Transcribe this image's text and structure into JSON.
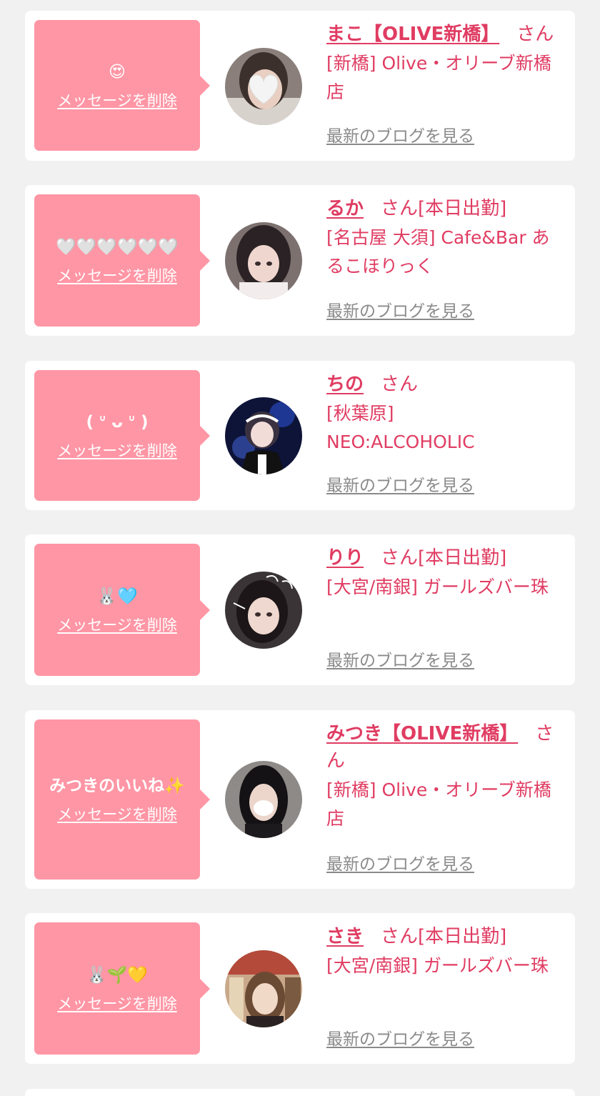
{
  "delete_label": "メッセージを削除",
  "blog_label": "最新のブログを見る",
  "colors": {
    "accent": "#e03c62",
    "bubble": "#ff96a5",
    "background": "#f1f1f1"
  },
  "cards": [
    {
      "message": "😍",
      "name": "まこ【OLIVE新橋】",
      "san": "さん",
      "status": "",
      "shop": "[新橋] Olive・オリーブ新橋店",
      "avatar": "heart-sticker-photo"
    },
    {
      "message": "🤍🤍🤍🤍🤍🤍",
      "name": "るか",
      "san": "さん",
      "status": "[本日出勤]",
      "shop": "[名古屋 大須] Cafe&Bar あるこほりっく",
      "avatar": "girl-photo"
    },
    {
      "message": "(  ᐡ ᴗ ᐡ )",
      "name": "ちの",
      "san": "さん",
      "status": "",
      "shop": "[秋葉原] NEO:ALCOHOLIC",
      "avatar": "maid-photo"
    },
    {
      "message": "🐰🩵",
      "name": "りり",
      "san": "さん",
      "status": "[本日出勤]",
      "shop": "[大宮/南銀] ガールズバー珠",
      "avatar": "girl-photo"
    },
    {
      "message": "みつきのいいね✨",
      "name": "みつき【OLIVE新橋】",
      "san": "さん",
      "status": "",
      "shop": "[新橋] Olive・オリーブ新橋店",
      "avatar": "mask-photo"
    },
    {
      "message": "🐰🌱💛",
      "name": "さき",
      "san": "さん",
      "status": "[本日出勤]",
      "shop": "[大宮/南銀] ガールズバー珠",
      "avatar": "girl-photo"
    }
  ]
}
